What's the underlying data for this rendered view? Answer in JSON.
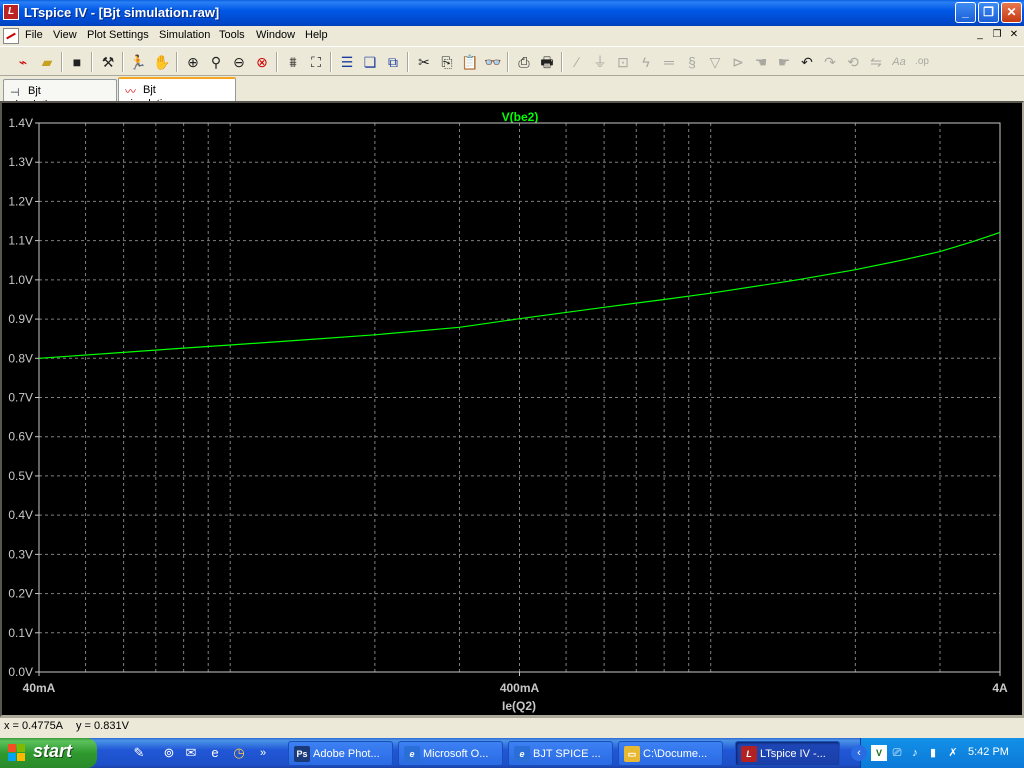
{
  "window": {
    "title": "LTspice IV - [Bjt simulation.raw]",
    "app_icon_text": "L"
  },
  "menu": {
    "items": [
      "File",
      "View",
      "Plot Settings",
      "Simulation",
      "Tools",
      "Window",
      "Help"
    ]
  },
  "tabs": [
    {
      "label": "Bjt simulation.asc",
      "active": false
    },
    {
      "label": "Bjt simulation.raw",
      "active": true
    }
  ],
  "chart_data": {
    "type": "line",
    "title": "V(be2)",
    "xlabel": "Ie(Q2)",
    "ylabel": "",
    "x_scale": "log",
    "xlim": [
      0.04,
      4
    ],
    "ylim": [
      0.0,
      1.4
    ],
    "x_tick_labels": [
      "40mA",
      "400mA",
      "4A"
    ],
    "y_tick_labels": [
      "0.0V",
      "0.1V",
      "0.2V",
      "0.3V",
      "0.4V",
      "0.5V",
      "0.6V",
      "0.7V",
      "0.8V",
      "0.9V",
      "1.0V",
      "1.1V",
      "1.2V",
      "1.3V",
      "1.4V"
    ],
    "grid": true,
    "series": [
      {
        "name": "V(be2)",
        "color": "#00ff00",
        "x": [
          0.04,
          0.06,
          0.08,
          0.1,
          0.15,
          0.2,
          0.3,
          0.4,
          0.6,
          0.8,
          1.0,
          1.5,
          2.0,
          2.5,
          3.0,
          3.5,
          4.0
        ],
        "y": [
          0.8,
          0.815,
          0.826,
          0.834,
          0.849,
          0.86,
          0.879,
          0.901,
          0.93,
          0.95,
          0.966,
          0.999,
          1.026,
          1.05,
          1.072,
          1.097,
          1.121
        ]
      }
    ]
  },
  "status": {
    "x_readout": "x = 0.4775A",
    "y_readout": "y = 0.831V"
  },
  "taskbar": {
    "start_label": "start",
    "tasks": [
      {
        "label": "Adobe Phot...",
        "icon": "Ps",
        "icon_color": "#1a3a7a"
      },
      {
        "label": "Microsoft O...",
        "icon": "e",
        "icon_color": "#2a6fd8"
      },
      {
        "label": "BJT SPICE ...",
        "icon": "e",
        "icon_color": "#2a6fd8"
      },
      {
        "label": "C:\\Docume...",
        "icon": "▭",
        "icon_color": "#e8b830"
      },
      {
        "label": "LTspice IV -...",
        "icon": "L",
        "icon_color": "#b22222"
      }
    ],
    "clock": "5:42 PM"
  }
}
